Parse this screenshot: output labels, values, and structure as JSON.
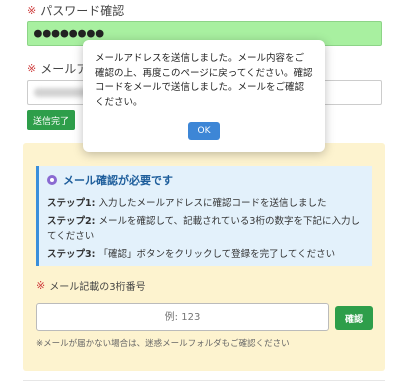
{
  "required_mark": "※",
  "password_confirm": {
    "label": "パスワード確認",
    "value": "●●●●●●●●"
  },
  "email": {
    "label": "メールアドレス",
    "sent_button": "送信完了"
  },
  "notice": {
    "title": "メール確認が必要です",
    "steps": [
      {
        "head": "ステップ1:",
        "text": " 入力したメールアドレスに確認コードを送信しました"
      },
      {
        "head": "ステップ2:",
        "text": " メールを確認して、記載されている3桁の数字を下記に入力してください"
      },
      {
        "head": "ステップ3:",
        "text": " 「確認」ボタンをクリックして登録を完了してください"
      }
    ]
  },
  "code": {
    "label": "メール記載の3桁番号",
    "placeholder": "例: 123",
    "confirm_button": "確認",
    "hint": "※メールが届かない場合は、迷惑メールフォルダもご確認ください"
  },
  "dialog": {
    "message": "メールアドレスを送信しました。メール内容をご確認の上、再度このページに戻ってください。確認コードをメールで送信しました。メールをご確認ください。",
    "ok_button": "OK"
  },
  "colors": {
    "password_fill": "#a8f0a0",
    "primary_green": "#2e9e4a",
    "panel_bg": "#fdf3cf",
    "notice_bg": "#e3f1fb",
    "ok_blue": "#3d86d6"
  }
}
